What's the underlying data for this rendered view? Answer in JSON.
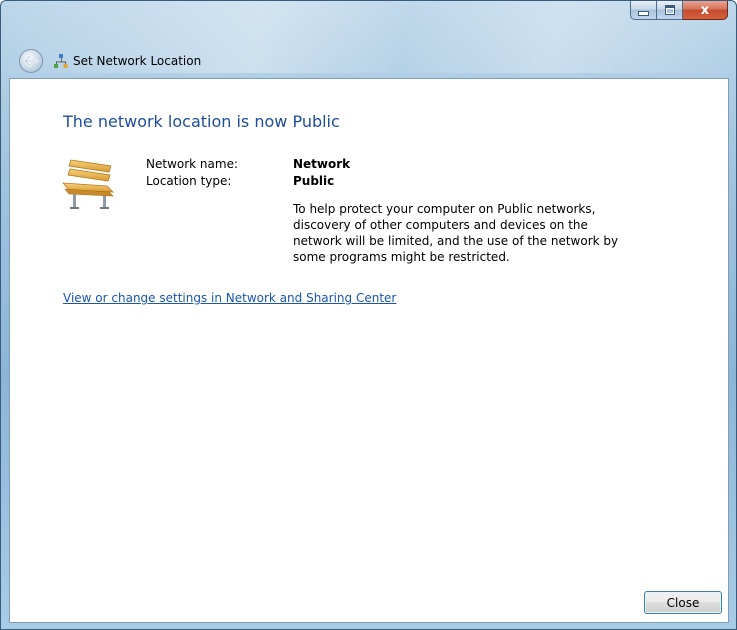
{
  "window": {
    "title": "Set Network Location",
    "caption_buttons": {
      "close_glyph": "x"
    }
  },
  "colors": {
    "headline": "#1e4d9b",
    "link": "#1a56b4",
    "close_button_border": "#3c7fb1"
  },
  "icons": {
    "back": "back-arrow-icon",
    "network": "network-icon",
    "location": "park-bench-icon"
  },
  "main": {
    "headline": "The network location is now Public",
    "fields": [
      {
        "label": "Network name:",
        "value": "Network"
      },
      {
        "label": "Location type:",
        "value": "Public"
      }
    ],
    "description": "To help protect your computer on Public networks, discovery of other computers and devices on the network will be limited, and the use of the network by some programs might be restricted.",
    "link_text": "View or change settings in Network and Sharing Center",
    "close_label": "Close"
  }
}
